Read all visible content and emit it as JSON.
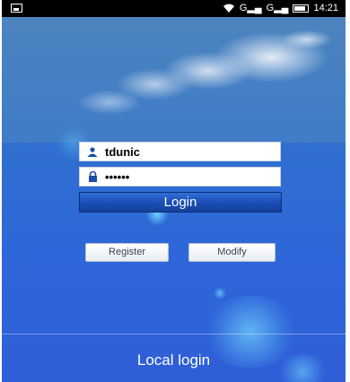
{
  "status_bar": {
    "time": "14:21",
    "network_1": "G",
    "network_2": "G"
  },
  "form": {
    "username_value": "tdunic",
    "password_value": "••••••",
    "login_label": "Login",
    "register_label": "Register",
    "modify_label": "Modify"
  },
  "footer": {
    "local_login_label": "Local login"
  },
  "colors": {
    "login_button": "#1c4fb8",
    "background": "#2f66da"
  },
  "icons": [
    "picture-icon",
    "wifi-icon",
    "signal-icon",
    "battery-icon",
    "user-icon",
    "lock-icon"
  ]
}
